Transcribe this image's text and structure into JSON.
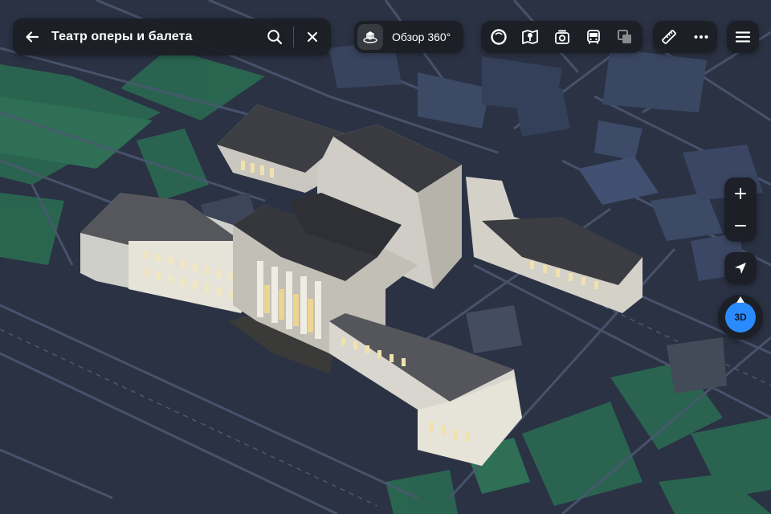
{
  "search": {
    "query": "Театр оперы и балета",
    "back_icon": "arrow-left-icon",
    "search_icon": "search-icon",
    "clear_icon": "close-icon"
  },
  "panorama": {
    "label": "Обзор 360°",
    "icon": "panorama-360-icon"
  },
  "layers": [
    {
      "name": "layer-circle",
      "icon": "circle-layer-icon"
    },
    {
      "name": "layer-map",
      "icon": "map-pin-layer-icon"
    },
    {
      "name": "layer-photos",
      "icon": "camera-layer-icon"
    },
    {
      "name": "layer-transit",
      "icon": "bus-icon"
    },
    {
      "name": "layer-overlay",
      "icon": "layers-icon"
    }
  ],
  "tools": [
    {
      "name": "ruler",
      "icon": "ruler-icon"
    },
    {
      "name": "more",
      "icon": "more-dots-icon"
    }
  ],
  "menu_icon": "hamburger-menu-icon",
  "zoom": {
    "in_icon": "plus-icon",
    "out_icon": "minus-icon"
  },
  "locate_icon": "location-arrow-icon",
  "compass": {
    "label": "3D"
  },
  "colors": {
    "panel_bg": "#1c1e24",
    "accent_blue": "#2a8bff",
    "map_background": "#2b3244",
    "road": "#4a5670",
    "park": "#2a6a52",
    "building_light": "#d8d8d4",
    "roof": "#3a3b40"
  }
}
